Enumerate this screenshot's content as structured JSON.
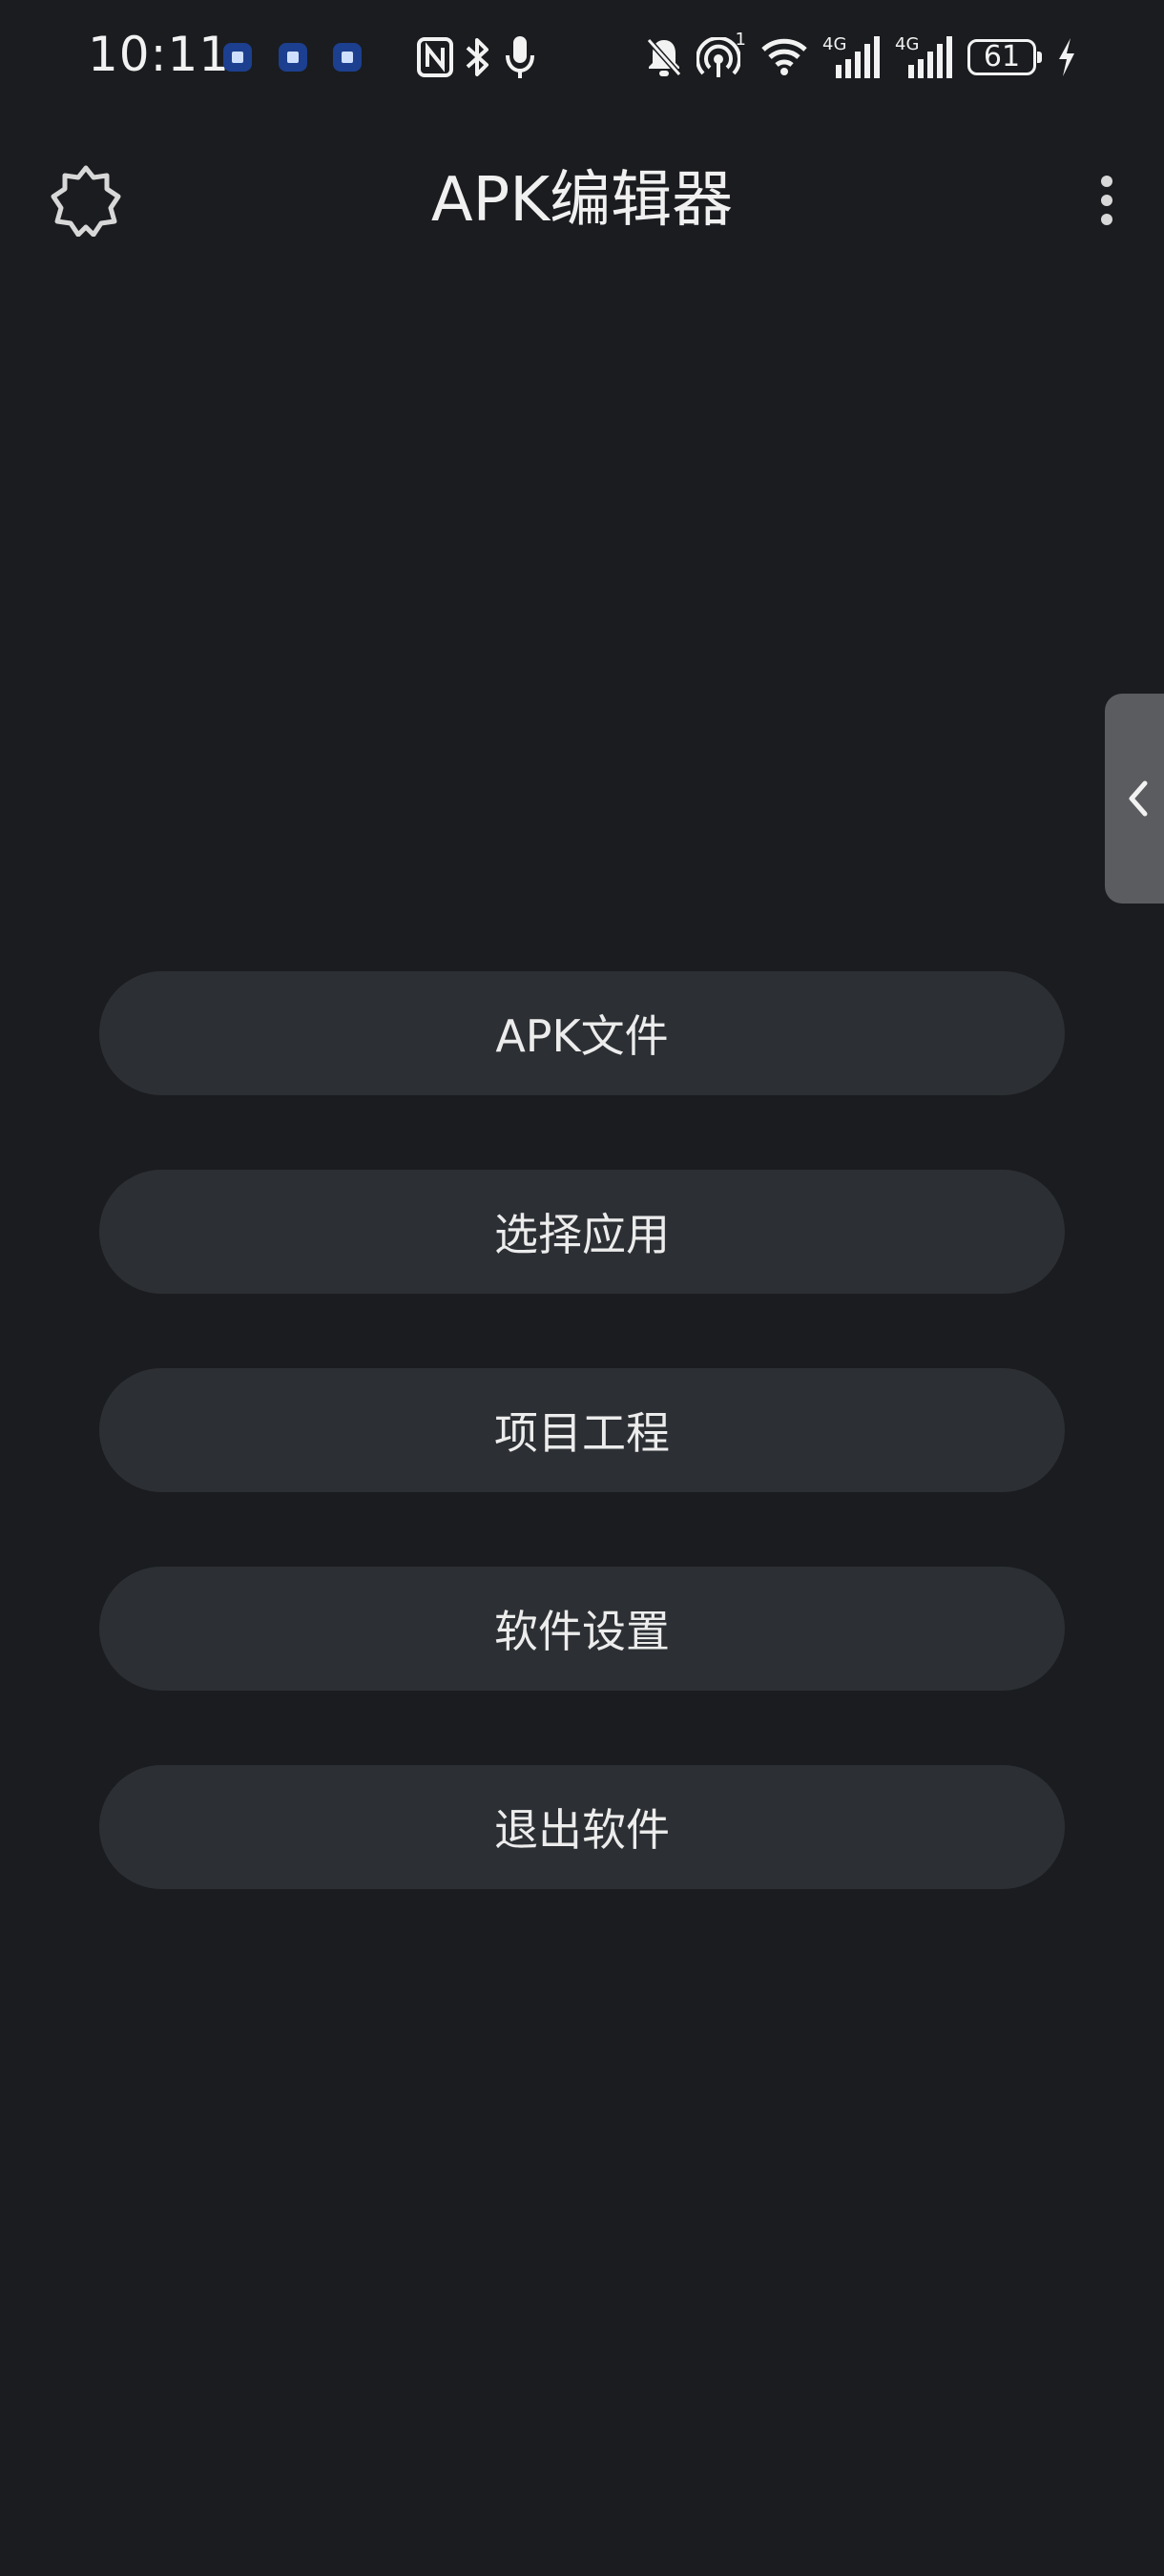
{
  "status_bar": {
    "time": "10:11",
    "network_1": "4G",
    "network_2": "4G",
    "battery": "61",
    "hotspot_count": "1"
  },
  "app_bar": {
    "title": "APK编辑器",
    "left_icon": "theme-brightness-icon",
    "right_icon": "more-vert-icon"
  },
  "side_tab": {
    "icon": "chevron-left-icon"
  },
  "menu": {
    "items": [
      {
        "label": "APK文件"
      },
      {
        "label": "选择应用"
      },
      {
        "label": "项目工程"
      },
      {
        "label": "软件设置"
      },
      {
        "label": "退出软件"
      }
    ]
  },
  "colors": {
    "background": "#1a1c1f",
    "button": "#2c2f33",
    "text": "#ececec",
    "side_tab": "#5a5c60"
  }
}
